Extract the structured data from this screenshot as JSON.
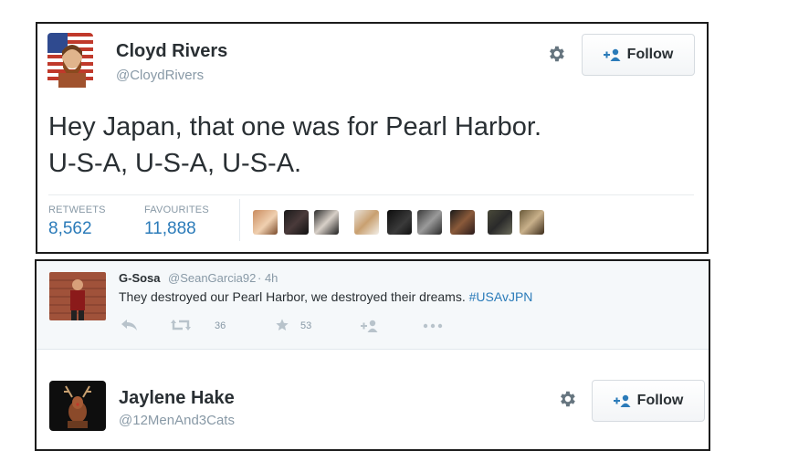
{
  "tweet1": {
    "user_name": "Cloyd Rivers",
    "user_handle": "@CloydRivers",
    "follow_label": "Follow",
    "text_line1": "Hey Japan, that one was for Pearl Harbor.",
    "text_line2": "U-S-A, U-S-A, U-S-A.",
    "retweets_label": "RETWEETS",
    "retweets_count": "8,562",
    "favourites_label": "FAVOURITES",
    "favourites_count": "11,888"
  },
  "reply": {
    "user_name": "G-Sosa",
    "user_handle": "@SeanGarcia92",
    "time": "· 4h",
    "text": "They destroyed our Pearl Harbor, we destroyed their dreams.",
    "hashtag": "#USAvJPN",
    "retweet_count": "36",
    "favorite_count": "53"
  },
  "tweet2": {
    "user_name": "Jaylene Hake",
    "user_handle": "@12MenAnd3Cats",
    "follow_label": "Follow"
  },
  "colors": {
    "link_blue": "#2b7bb9",
    "muted_gray": "#8899a6",
    "text_dark": "#292f33",
    "reply_bg": "#f5f8fa"
  },
  "icons": [
    "gear-icon",
    "follow-person-icon",
    "reply-icon",
    "retweet-icon",
    "favorite-icon",
    "more-icon"
  ]
}
